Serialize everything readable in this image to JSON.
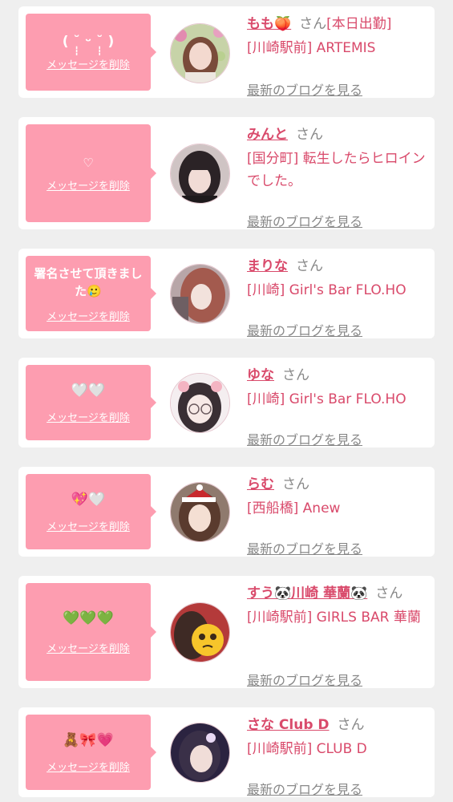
{
  "delete_label": "メッセージを削除",
  "blog_label": "最新のブログを見る",
  "honorific": "さん",
  "colors": {
    "bubble": "#fd9db0",
    "name": "#d94a6b",
    "muted": "#888888"
  },
  "entries": [
    {
      "message": "( ˘̩̩̩ ᵕ ˘̩̩̩ )",
      "name": "もも🍑",
      "tag": "[本日出勤]",
      "shop": "[川崎駅前] ARTEMIS"
    },
    {
      "message": "♡",
      "name": "みんと",
      "tag": "",
      "shop": "[国分町] 転生したらヒロインでした。"
    },
    {
      "message": "署名させて頂きました🥲",
      "name": "まりな",
      "tag": "",
      "shop": "[川崎] Girl's Bar FLO.HO"
    },
    {
      "message": "🤍🤍",
      "name": "ゆな",
      "tag": "",
      "shop": "[川崎] Girl's Bar FLO.HO"
    },
    {
      "message": "💖🤍",
      "name": "らむ",
      "tag": "",
      "shop": "[西船橋] Anew"
    },
    {
      "message": "💚💚💚",
      "name": "すう🐼川崎 華蘭🐼",
      "tag": "",
      "shop": "[川崎駅前] GIRLS BAR 華蘭"
    },
    {
      "message": "🧸🎀💗",
      "name": "さな Club D",
      "tag": "",
      "shop": "[川崎駅前] CLUB D"
    }
  ]
}
